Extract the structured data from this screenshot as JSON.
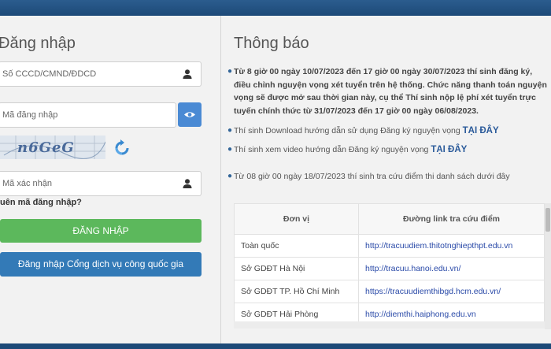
{
  "login": {
    "title": "Đăng nhập",
    "id_placeholder": "Số CCCD/CMND/ĐDCD",
    "code_placeholder": "Mã đăng nhập",
    "captcha_text": "n6GeG",
    "verify_placeholder": "Mã xác nhận",
    "forgot": "uên mã đăng nhập?",
    "login_button": "ĐĂNG NHẬP",
    "portal_button": "Đăng nhập Cổng dịch vụ công quốc gia"
  },
  "notice": {
    "title": "Thông báo",
    "items": [
      {
        "text": "Từ 8 giờ 00 ngày 10/07/2023 đến 17 giờ 00 ngày 30/07/2023 thí sinh đăng ký, điều chỉnh nguyện vọng xét tuyển trên hệ thống. Chức năng thanh toán nguyện vọng sẽ được mở sau thời gian này, cụ thể Thí sinh nộp lệ phí xét tuyển trực tuyến chính thức từ 31/07/2023 đến 17 giờ 00 ngày 06/08/2023."
      },
      {
        "text": "Thí sinh Download hướng dẫn sử dụng Đăng ký nguyện vọng ",
        "link": "TẠI ĐÂY"
      },
      {
        "text": "Thí sinh xem video hướng dẫn Đăng ký nguyện vọng ",
        "link": "TẠI ĐÂY"
      },
      {
        "text": "Từ 08 giờ 00 ngày 18/07/2023 thí sinh tra cứu điểm thi danh sách dưới đây"
      }
    ]
  },
  "table": {
    "headers": [
      "Đơn vị",
      "Đường link tra cứu điểm"
    ],
    "rows": [
      [
        "Toàn quốc",
        "http://tracuudiem.thitotnghiepthpt.edu.vn"
      ],
      [
        "Sở GDĐT Hà Nội",
        "http://tracuu.hanoi.edu.vn/"
      ],
      [
        "Sở GDĐT TP. Hồ Chí Minh",
        "https://tracuudiemthibgd.hcm.edu.vn/"
      ],
      [
        "Sở GDĐT Hải Phòng",
        "http://diemthi.haiphong.edu.vn"
      ]
    ]
  },
  "colors": {
    "login_green": "#5cb85c",
    "portal_blue": "#337ab7",
    "eye_blue": "#4a8ad4"
  },
  "icons": {
    "id_field": "user-icon",
    "verify_field": "user-icon",
    "password_toggle": "eye-icon",
    "captcha_refresh": "refresh-icon"
  }
}
